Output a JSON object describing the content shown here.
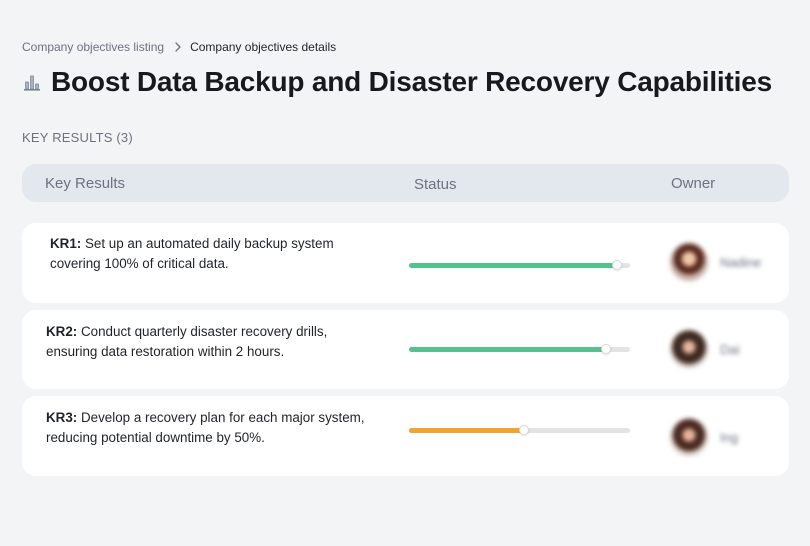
{
  "breadcrumb": {
    "parent": "Company objectives listing",
    "current": "Company objectives details"
  },
  "page": {
    "title": "Boost Data Backup and Disaster Recovery Capabilities",
    "title_icon": "bar-chart-icon"
  },
  "section": {
    "label": "KEY RESULTS (3)"
  },
  "table": {
    "columns": {
      "key_results": "Key Results",
      "status": "Status",
      "owner": "Owner"
    },
    "rows": [
      {
        "label": "KR1:",
        "text": "Set up an automated daily backup system covering 100% of critical data.",
        "progress": 0.94,
        "status_color": "#55c28e",
        "owner": "Nadine"
      },
      {
        "label": "KR2:",
        "text": "Conduct quarterly disaster recovery drills, ensuring data restoration within 2 hours.",
        "progress": 0.89,
        "status_color": "#55c28e",
        "owner": "Dai"
      },
      {
        "label": "KR3:",
        "text": "Develop a recovery plan for each major system, reducing potential downtime by 50%.",
        "progress": 0.52,
        "status_color": "#f5a32b",
        "owner": "Ing"
      }
    ]
  },
  "colors": {
    "background": "#f3f4f6",
    "header_bg": "#e3e7ee",
    "on_track": "#55c28e",
    "at_risk": "#f5a32b"
  }
}
